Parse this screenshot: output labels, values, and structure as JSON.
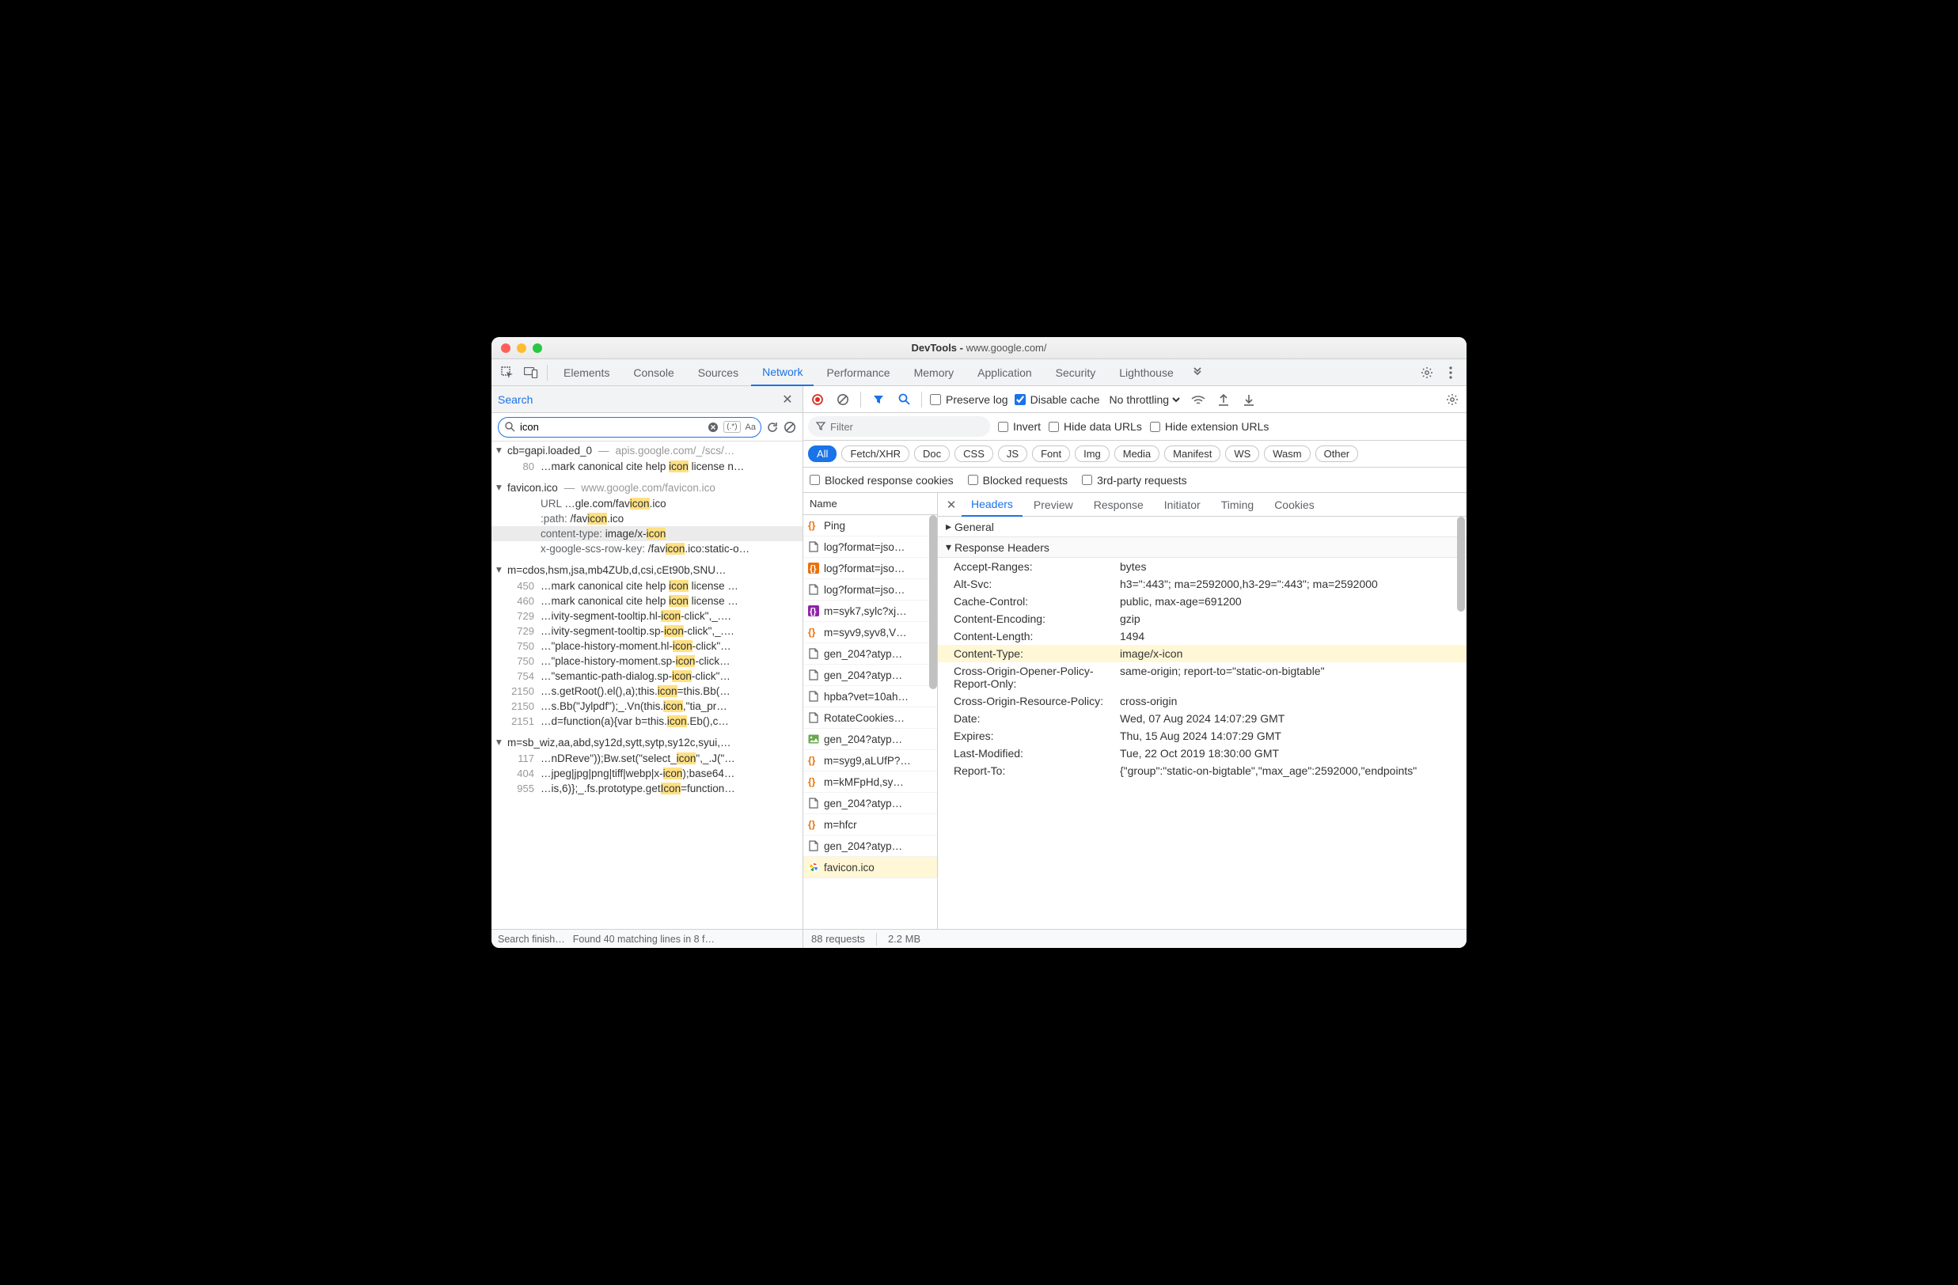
{
  "title": {
    "app": "DevTools",
    "url": "www.google.com/"
  },
  "tabs": [
    "Elements",
    "Console",
    "Sources",
    "Network",
    "Performance",
    "Memory",
    "Application",
    "Security",
    "Lighthouse"
  ],
  "active_tab": "Network",
  "search_panel": {
    "label": "Search",
    "query": "icon",
    "regex_label": "(.*)",
    "case_label": "Aa",
    "footer_left": "Search finish…",
    "footer_right": "Found 40 matching lines in 8 f…",
    "files": [
      {
        "name": "cb=gapi.loaded_0",
        "path": "apis.google.com/_/scs/…",
        "lines": [
          {
            "ln": "80",
            "pre": "…mark canonical cite help ",
            "hl": "icon",
            "post": " license n…"
          }
        ]
      },
      {
        "name": "favicon.ico",
        "path": "www.google.com/favicon.ico",
        "lines": [
          {
            "ln": "",
            "key": "URL",
            "pre": "…gle.com/fav",
            "hl": "icon",
            "post": ".ico"
          },
          {
            "ln": "",
            "key": ":path:",
            "pre": "/fav",
            "hl": "icon",
            "post": ".ico"
          },
          {
            "ln": "",
            "key": "content-type:",
            "pre": "image/x-",
            "hl": "icon",
            "post": "",
            "row_hl": true
          },
          {
            "ln": "",
            "key": "x-google-scs-row-key:",
            "pre": "/fav",
            "hl": "icon",
            "post": ".ico:static-o…"
          }
        ]
      },
      {
        "name": "m=cdos,hsm,jsa,mb4ZUb,d,csi,cEt90b,SNU…",
        "path": "",
        "lines": [
          {
            "ln": "450",
            "pre": "…mark canonical cite help ",
            "hl": "icon",
            "post": " license …"
          },
          {
            "ln": "460",
            "pre": "…mark canonical cite help ",
            "hl": "icon",
            "post": " license …"
          },
          {
            "ln": "729",
            "pre": "…ivity-segment-tooltip.hl-",
            "hl": "icon",
            "post": "-click\",_.…"
          },
          {
            "ln": "729",
            "pre": "…ivity-segment-tooltip.sp-",
            "hl": "icon",
            "post": "-click\",_.…"
          },
          {
            "ln": "750",
            "pre": "…\"place-history-moment.hl-",
            "hl": "icon",
            "post": "-click\"…"
          },
          {
            "ln": "750",
            "pre": "…\"place-history-moment.sp-",
            "hl": "icon",
            "post": "-click…"
          },
          {
            "ln": "754",
            "pre": "…\"semantic-path-dialog.sp-",
            "hl": "icon",
            "post": "-click\"…"
          },
          {
            "ln": "2150",
            "pre": "…s.getRoot().el(),a);this.",
            "hl": "icon",
            "post": "=this.Bb(…"
          },
          {
            "ln": "2150",
            "pre": "…s.Bb(\"Jylpdf\");_.Vn(this.",
            "hl": "icon",
            "post": ",\"tia_pr…"
          },
          {
            "ln": "2151",
            "pre": "…d=function(a){var b=this.",
            "hl": "icon",
            "post": ".Eb(),c…"
          }
        ]
      },
      {
        "name": "m=sb_wiz,aa,abd,sy12d,sytt,sytp,sy12c,syui,…",
        "path": "",
        "lines": [
          {
            "ln": "117",
            "pre": "…nDReve\"));Bw.set(\"select_",
            "hl": "icon",
            "post": "\",_.J(\"…"
          },
          {
            "ln": "404",
            "pre": "…jpeg|jpg|png|tiff|webp|x-",
            "hl": "icon",
            "post": ");base64…"
          },
          {
            "ln": "955",
            "pre": "…is,6)};_.fs.prototype.get",
            "hl": "Icon",
            "post": "=function…"
          }
        ]
      }
    ]
  },
  "network": {
    "preserve_log": false,
    "preserve_log_label": "Preserve log",
    "disable_cache": true,
    "disable_cache_label": "Disable cache",
    "throttling": "No throttling",
    "filter_placeholder": "Filter",
    "invert_label": "Invert",
    "hide_data_urls_label": "Hide data URLs",
    "hide_ext_urls_label": "Hide extension URLs",
    "types": [
      "All",
      "Fetch/XHR",
      "Doc",
      "CSS",
      "JS",
      "Font",
      "Img",
      "Media",
      "Manifest",
      "WS",
      "Wasm",
      "Other"
    ],
    "active_type": "All",
    "blocked_cookies_label": "Blocked response cookies",
    "blocked_requests_label": "Blocked requests",
    "third_party_label": "3rd-party requests",
    "name_header": "Name",
    "requests": [
      {
        "icon": "braces-orange",
        "name": "Ping"
      },
      {
        "icon": "doc",
        "name": "log?format=jso…"
      },
      {
        "icon": "braces-orange-box",
        "name": "log?format=jso…"
      },
      {
        "icon": "doc",
        "name": "log?format=jso…"
      },
      {
        "icon": "braces-purple-box",
        "name": "m=syk7,sylc?xj…"
      },
      {
        "icon": "braces-orange",
        "name": "m=syv9,syv8,V…"
      },
      {
        "icon": "doc",
        "name": "gen_204?atyp…"
      },
      {
        "icon": "doc",
        "name": "gen_204?atyp…"
      },
      {
        "icon": "doc",
        "name": "hpba?vet=10ah…"
      },
      {
        "icon": "doc",
        "name": "RotateCookies…"
      },
      {
        "icon": "img",
        "name": "gen_204?atyp…"
      },
      {
        "icon": "braces-orange",
        "name": "m=syg9,aLUfP?…"
      },
      {
        "icon": "braces-orange",
        "name": "m=kMFpHd,sy…"
      },
      {
        "icon": "doc",
        "name": "gen_204?atyp…"
      },
      {
        "icon": "braces-orange",
        "name": "m=hfcr"
      },
      {
        "icon": "doc",
        "name": "gen_204?atyp…"
      },
      {
        "icon": "google",
        "name": "favicon.ico",
        "selected": true
      }
    ],
    "footer": {
      "requests": "88 requests",
      "size": "2.2 MB"
    }
  },
  "detail": {
    "tabs": [
      "Headers",
      "Preview",
      "Response",
      "Initiator",
      "Timing",
      "Cookies"
    ],
    "active_tab": "Headers",
    "general_label": "General",
    "response_headers_label": "Response Headers",
    "headers": [
      {
        "k": "Accept-Ranges:",
        "v": "bytes"
      },
      {
        "k": "Alt-Svc:",
        "v": "h3=\":443\"; ma=2592000,h3-29=\":443\"; ma=2592000"
      },
      {
        "k": "Cache-Control:",
        "v": "public, max-age=691200"
      },
      {
        "k": "Content-Encoding:",
        "v": "gzip"
      },
      {
        "k": "Content-Length:",
        "v": "1494"
      },
      {
        "k": "Content-Type:",
        "v": "image/x-icon",
        "hl": true
      },
      {
        "k": "Cross-Origin-Opener-Policy-Report-Only:",
        "v": "same-origin; report-to=\"static-on-bigtable\""
      },
      {
        "k": "Cross-Origin-Resource-Policy:",
        "v": "cross-origin"
      },
      {
        "k": "Date:",
        "v": "Wed, 07 Aug 2024 14:07:29 GMT"
      },
      {
        "k": "Expires:",
        "v": "Thu, 15 Aug 2024 14:07:29 GMT"
      },
      {
        "k": "Last-Modified:",
        "v": "Tue, 22 Oct 2019 18:30:00 GMT"
      },
      {
        "k": "Report-To:",
        "v": "{\"group\":\"static-on-bigtable\",\"max_age\":2592000,\"endpoints\""
      }
    ]
  }
}
